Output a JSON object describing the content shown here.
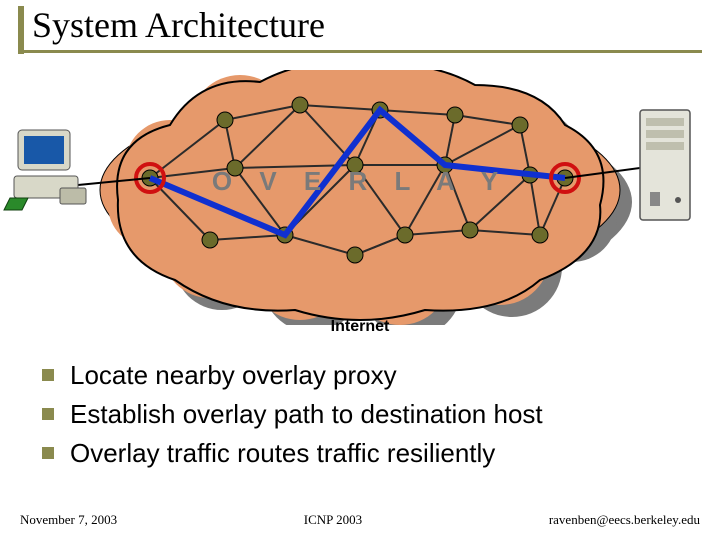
{
  "title": "System Architecture",
  "diagram": {
    "overlay_label": "O V E R L A Y",
    "internet_label": "Internet"
  },
  "bullets": [
    "Locate nearby overlay proxy",
    "Establish overlay path to destination host",
    "Overlay traffic routes traffic resiliently"
  ],
  "footer": {
    "date": "November 7, 2003",
    "venue": "ICNP 2003",
    "email": "ravenben@eecs.berkeley.edu"
  }
}
